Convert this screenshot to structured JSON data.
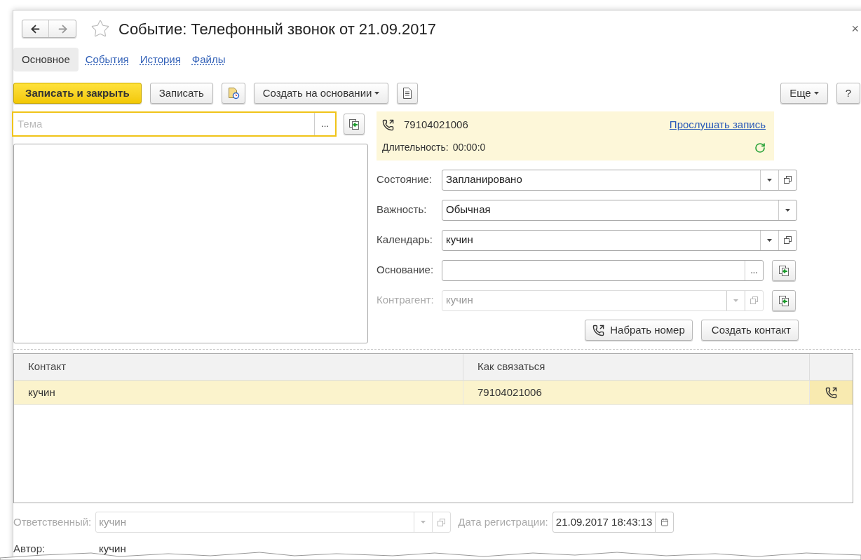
{
  "window": {
    "title": "Событие: Телефонный звонок от 21.09.2017",
    "close": "×",
    "favorite": false
  },
  "tabs": [
    {
      "label": "Основное",
      "selected": true
    },
    {
      "label": "События",
      "selected": false
    },
    {
      "label": "История",
      "selected": false
    },
    {
      "label": "Файлы",
      "selected": false
    }
  ],
  "toolbar": [
    {
      "kind": "primary",
      "label": "Записать и закрыть"
    },
    {
      "kind": "default",
      "label": "Записать"
    },
    {
      "kind": "report-icon"
    },
    {
      "kind": "menu",
      "label": "Создать на основании"
    },
    {
      "kind": "doc-icon"
    }
  ],
  "toolbar_right": [
    {
      "kind": "menu",
      "label": "Еще"
    },
    {
      "kind": "default",
      "label": "?"
    }
  ],
  "subject": {
    "placeholder": "Тема",
    "ellipsis": "..."
  },
  "call": {
    "number": "79104021006",
    "link": "Прослушать запись",
    "duration_label": "Длительность:",
    "duration": "00:00:0"
  },
  "fields": [
    {
      "label": "Состояние:",
      "value": "Запланировано",
      "dropdown": true,
      "open_button": true,
      "pick_button": false,
      "disabled": false
    },
    {
      "label": "Важность:",
      "value": "Обычная",
      "dropdown": true,
      "open_button": false,
      "pick_button": false,
      "disabled": false
    },
    {
      "label": "Календарь:",
      "value": "кучин",
      "dropdown": true,
      "open_button": true,
      "pick_button": false,
      "disabled": false
    },
    {
      "label": "Основание:",
      "ellipsis": "...",
      "dropdown": false,
      "open_button": false,
      "pick_button": true,
      "disabled": false
    },
    {
      "label": "Контрагент:",
      "value": "кучин",
      "dropdown": true,
      "open_button": true,
      "pick_button": true,
      "disabled": true
    }
  ],
  "actions": [
    {
      "label": "Набрать номер",
      "icon": true
    },
    {
      "label": "Создать контакт",
      "icon": false
    }
  ],
  "table": {
    "columns": [
      "Контакт",
      "Как связаться"
    ],
    "rows": [
      {
        "contact": "кучин",
        "how": "79104021006",
        "selected": true
      }
    ]
  },
  "footer": {
    "responsible_label": "Ответственный:",
    "responsible": "кучин",
    "responsible_disabled": true,
    "date_label": "Дата регистрации:",
    "date": "21.09.2017 18:43:13",
    "author_label": "Автор:",
    "author": "кучин"
  }
}
